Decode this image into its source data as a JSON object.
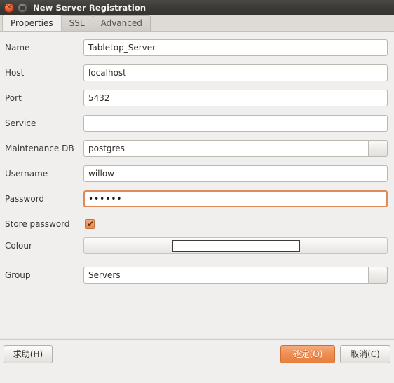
{
  "window": {
    "title": "New Server Registration",
    "controls": [
      {
        "name": "close",
        "glyph": "✕"
      },
      {
        "name": "maximize",
        "glyph": ""
      }
    ]
  },
  "tabs": [
    {
      "label": "Properties",
      "active": true
    },
    {
      "label": "SSL",
      "active": false
    },
    {
      "label": "Advanced",
      "active": false
    }
  ],
  "form": {
    "name": {
      "label": "Name",
      "value": "Tabletop_Server"
    },
    "host": {
      "label": "Host",
      "value": "localhost"
    },
    "port": {
      "label": "Port",
      "value": "5432"
    },
    "service": {
      "label": "Service",
      "value": ""
    },
    "maintenance_db": {
      "label": "Maintenance DB",
      "value": "postgres"
    },
    "username": {
      "label": "Username",
      "value": "willow"
    },
    "password": {
      "label": "Password",
      "value": "••••••"
    },
    "store_password": {
      "label": "Store password",
      "checked": true,
      "tick": "✔"
    },
    "colour": {
      "label": "Colour",
      "swatch": "#ffffff"
    },
    "group": {
      "label": "Group",
      "value": "Servers"
    }
  },
  "buttons": {
    "help": "求助(H)",
    "ok": "確定(O)",
    "cancel": "取消(C)"
  },
  "colors": {
    "accent": "#e87f3f",
    "titlebar": "#3b3a36",
    "background": "#f0efed",
    "focus_border": "#e08a5a"
  }
}
